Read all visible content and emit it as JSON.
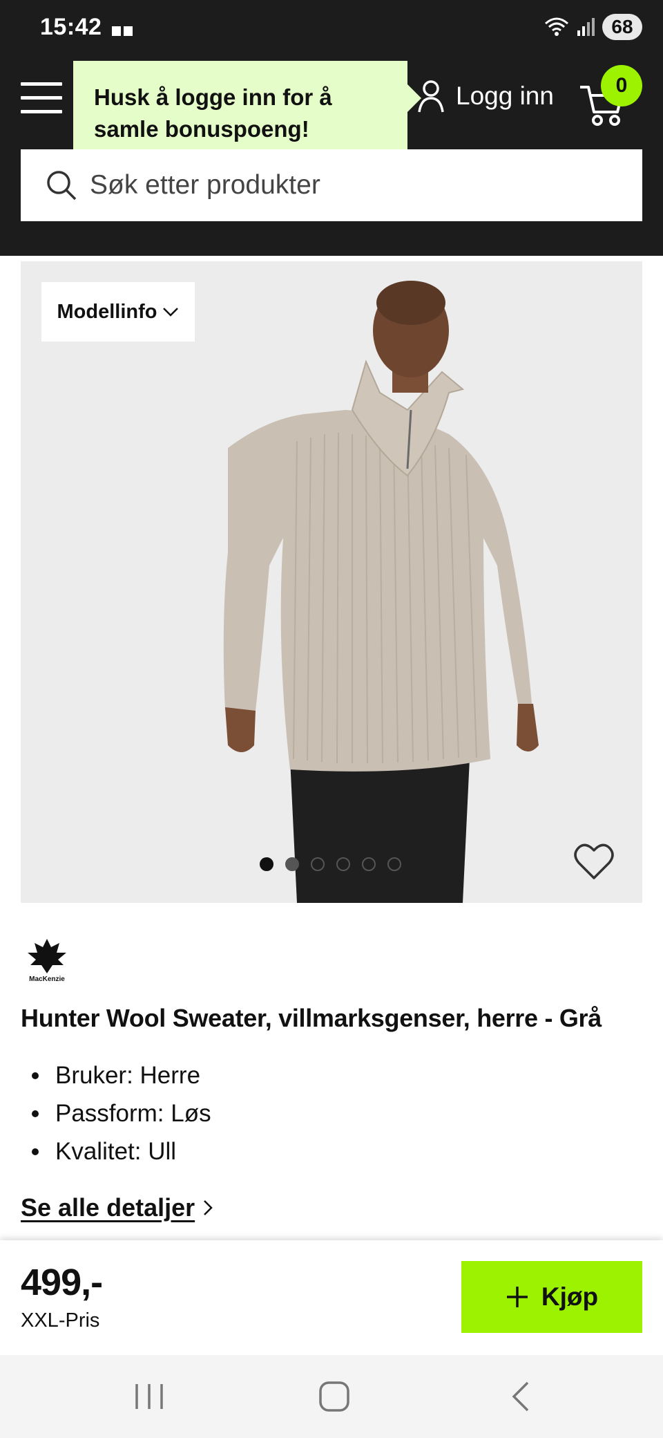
{
  "status_bar": {
    "time": "15:42",
    "battery": "68"
  },
  "header": {
    "tooltip": "Husk å logge inn for å samle bonuspoeng!",
    "login_label": "Logg inn",
    "cart_count": "0",
    "search_placeholder": "Søk etter produkter"
  },
  "gallery": {
    "model_info_label": "Modellinfo",
    "dot_count": 6,
    "active_dot": 1
  },
  "product": {
    "brand": "MacKenzie",
    "title": "Hunter Wool Sweater, villmarksgenser, herre - Grå",
    "features": [
      "Bruker: Herre",
      "Passform: Løs",
      "Kvalitet: Ull"
    ],
    "details_link": "Se alle detaljer"
  },
  "buy_bar": {
    "price": "499,-",
    "price_label": "XXL-Pris",
    "buy_label": "Kjøp"
  },
  "colors": {
    "accent": "#9cf200",
    "header_bg": "#1c1c1c",
    "tooltip_bg": "#e5fdc8"
  }
}
